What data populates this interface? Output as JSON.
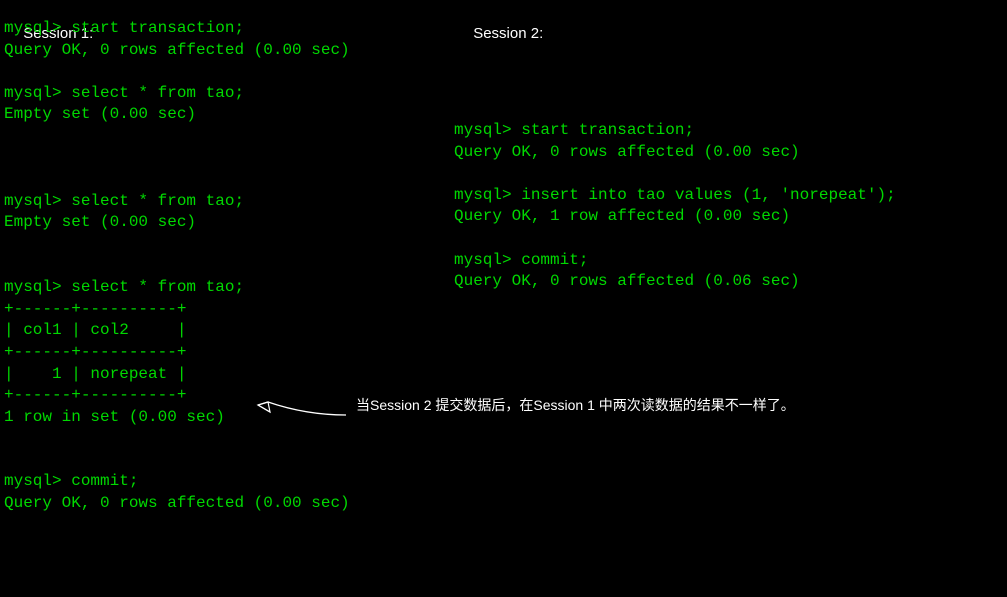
{
  "session1": {
    "label": "Session 1:",
    "body": "mysql> start transaction;\nQuery OK, 0 rows affected (0.00 sec)\n\nmysql> select * from tao;\nEmpty set (0.00 sec)\n\n\n\nmysql> select * from tao;\nEmpty set (0.00 sec)\n\n\nmysql> select * from tao;\n+------+----------+\n| col1 | col2     |\n+------+----------+\n|    1 | norepeat |\n+------+----------+\n1 row in set (0.00 sec)\n\n\nmysql> commit;\nQuery OK, 0 rows affected (0.00 sec)"
  },
  "session2": {
    "label": "Session 2:",
    "body": "mysql> start transaction;\nQuery OK, 0 rows affected (0.00 sec)\n\nmysql> insert into tao values (1, 'norepeat');\nQuery OK, 1 row affected (0.00 sec)\n\nmysql> commit;\nQuery OK, 0 rows affected (0.06 sec)"
  },
  "annotation": {
    "text": "当Session 2 提交数据后，在Session 1 中两次读数据的结果不一样了。"
  }
}
